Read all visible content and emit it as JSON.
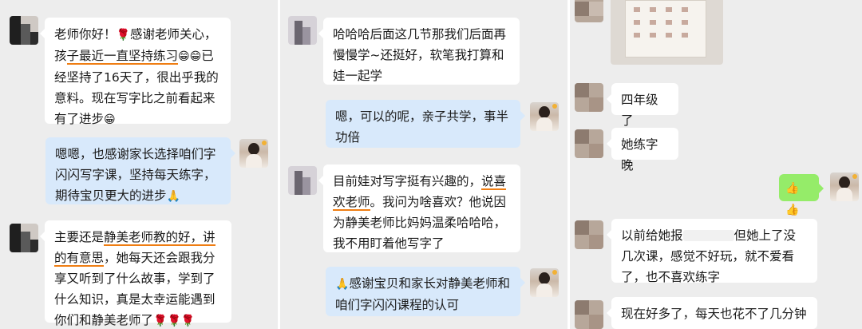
{
  "panel1": {
    "msg1": {
      "pre": "老师你好！",
      "rose": "🌹",
      "a": "感谢老师关心，孩",
      "ul": "子最近一直坚持练习",
      "grin": "😁😁",
      "b": "已经坚持了16天了，很出乎我的意料。现在写字比之前看起来有了进步",
      "grin2": "😁"
    },
    "msg2": "嗯嗯，也感谢家长选择咱们字闪闪写字课，坚持每天练字，期待宝贝更大的进步",
    "msg2_emo": "🙏",
    "msg3": {
      "a": "主要还是",
      "ul1": "静美老师教的好，讲的有意思",
      "b": "，她每天还会跟我分享又听到了什么故事，学到了什么知识，真是太幸运能遇到你们和静美老师了",
      "roses": "🌹🌹🌹"
    }
  },
  "panel2": {
    "msg1": "哈哈哈后面这几节那我们后面再慢慢学~还挺好，软笔我打算和娃一起学",
    "msg2": "嗯，可以的呢，亲子共学，事半功倍",
    "msg3": {
      "a": "目前娃对写字挺有兴趣的，",
      "ul": "说喜欢老师",
      "b": "。我问为啥喜欢？他说因为静美老师比妈妈温柔哈哈哈，我不用盯着他写字了"
    },
    "msg4_emo": "🙏",
    "msg4": "感谢宝贝和家长对静美老师和咱们字闪闪课程的认可"
  },
  "panel3": {
    "msg1": "四年级了",
    "msg2": "她练字晚",
    "msg3": "👍👍",
    "msg4": {
      "a": "以前给她报",
      "b": "但她上了没几次课，感觉不好玩，就不爱看了，也不喜欢练字"
    },
    "msg5": "现在好多了，每天也花不了几分钟"
  },
  "colors": {
    "chat_bg": "#ededed",
    "bubble_white": "#ffffff",
    "bubble_blue": "#d8e9fb",
    "bubble_green": "#95ec69",
    "underline": "#ef7d12"
  }
}
